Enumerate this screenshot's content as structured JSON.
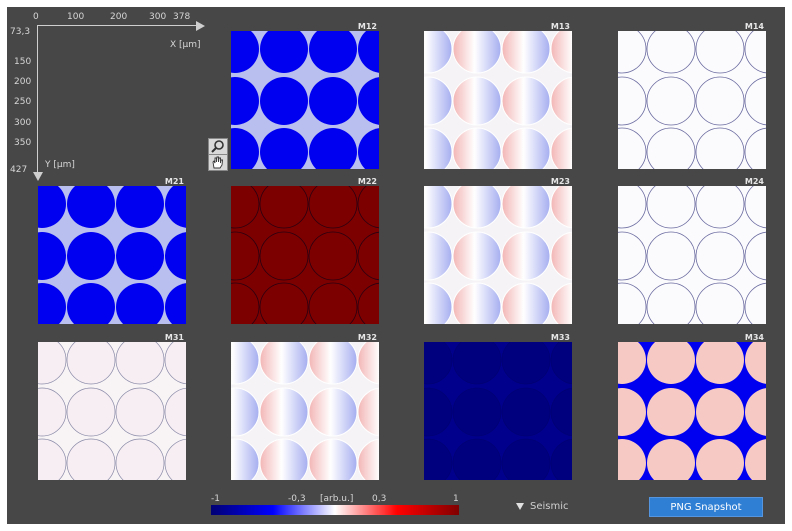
{
  "axes": {
    "x_ticks": [
      "0",
      "100",
      "200",
      "300",
      "378"
    ],
    "y_ticks": [
      "73,3",
      "150",
      "200",
      "250",
      "300",
      "350",
      "427"
    ],
    "x_label": "X [µm]",
    "y_label": "Y [µm]"
  },
  "tiles": [
    {
      "label": "M12",
      "pattern": "blue-discs"
    },
    {
      "label": "M13",
      "pattern": "red-blue-gradient"
    },
    {
      "label": "M14",
      "pattern": "white-rings"
    },
    {
      "label": "M21",
      "pattern": "blue-discs"
    },
    {
      "label": "M22",
      "pattern": "dark-red"
    },
    {
      "label": "M23",
      "pattern": "red-blue-gradient"
    },
    {
      "label": "M24",
      "pattern": "white-rings"
    },
    {
      "label": "M31",
      "pattern": "white-rings-faint"
    },
    {
      "label": "M32",
      "pattern": "red-blue-gradient"
    },
    {
      "label": "M33",
      "pattern": "dark-blue"
    },
    {
      "label": "M34",
      "pattern": "pink-discs"
    }
  ],
  "colorbar": {
    "min_label": "-1",
    "neg_label": "-0,3",
    "unit_label": "[arb.u.]",
    "pos_label": "0,3",
    "max_label": "1",
    "colors": [
      "#000074",
      "#0000ff",
      "#ffffff",
      "#ff0000",
      "#800000"
    ]
  },
  "colormap": {
    "label": "Seismic"
  },
  "snapshot_button": {
    "label": "PNG Snapshot"
  },
  "icons": [
    "zoom-icon",
    "pan-hand-icon",
    "dropdown-triangle-icon"
  ]
}
